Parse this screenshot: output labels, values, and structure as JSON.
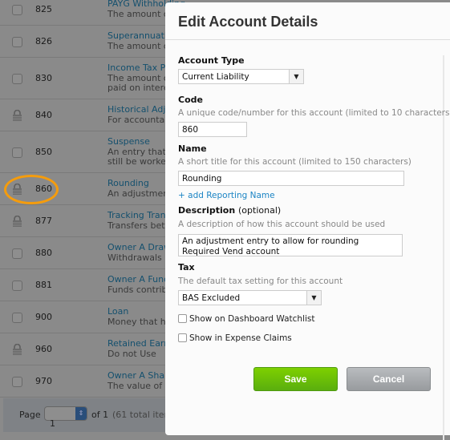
{
  "accounts": [
    {
      "code": "825",
      "name": "PAYG Withholding",
      "desc": [
        "The amount of"
      ],
      "locked": false
    },
    {
      "code": "826",
      "name": "Superannuation",
      "desc": [
        "The amount of"
      ],
      "locked": false
    },
    {
      "code": "830",
      "name": "Income Tax Pa",
      "desc": [
        "The amount of",
        "paid on interes"
      ],
      "locked": false
    },
    {
      "code": "840",
      "name": "Historical Adju",
      "desc": [
        "For accountant"
      ],
      "locked": true
    },
    {
      "code": "850",
      "name": "Suspense",
      "desc": [
        "An entry that a",
        "still be worked"
      ],
      "locked": false
    },
    {
      "code": "860",
      "name": "Rounding",
      "desc": [
        "An adjustment"
      ],
      "locked": true
    },
    {
      "code": "877",
      "name": "Tracking Trans",
      "desc": [
        "Transfers betw"
      ],
      "locked": true
    },
    {
      "code": "880",
      "name": "Owner A Drawi",
      "desc": [
        "Withdrawals by"
      ],
      "locked": false
    },
    {
      "code": "881",
      "name": "Owner A Funds",
      "desc": [
        "Funds contribu"
      ],
      "locked": false
    },
    {
      "code": "900",
      "name": "Loan",
      "desc": [
        "Money that has"
      ],
      "locked": false
    },
    {
      "code": "960",
      "name": "Retained Earnin",
      "desc": [
        "Do not Use"
      ],
      "locked": true
    },
    {
      "code": "970",
      "name": "Owner A Share",
      "desc": [
        "The value of sh"
      ],
      "locked": false
    }
  ],
  "pager": {
    "label": "Page",
    "value": "1",
    "of": "of 1",
    "total": "(61 total items)"
  },
  "highlight_color": "#f59c0c",
  "dialog": {
    "title": "Edit Account Details",
    "account_type_label": "Account Type",
    "account_type": "Current Liability",
    "code_label": "Code",
    "code_hint": "A unique code/number for this account (limited to 10 characters)",
    "code": "860",
    "name_label": "Name",
    "name_hint": "A short title for this account (limited to 150 characters)",
    "name": "Rounding",
    "add_reporting": "+ add Reporting Name",
    "desc_label": "Description",
    "desc_optional": "(optional)",
    "desc_hint": "A description of how this account should be used",
    "desc_line1": "An adjustment entry to allow for rounding",
    "desc_line2": "Required Vend account",
    "tax_label": "Tax",
    "tax_hint": "The default tax setting for this account",
    "tax": "BAS Excluded",
    "watchlist": "Show on Dashboard Watchlist",
    "watchlist_checked": false,
    "expense": "Show in Expense Claims",
    "expense_checked": false,
    "save": "Save",
    "cancel": "Cancel"
  }
}
